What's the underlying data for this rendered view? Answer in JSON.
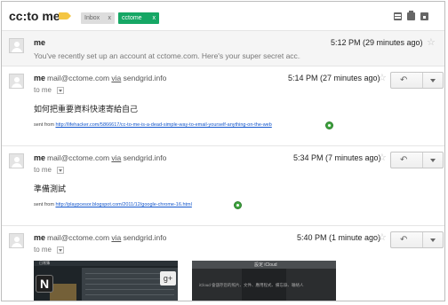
{
  "conversation": {
    "subject": "cc:to me",
    "labels": [
      {
        "text": "Inbox",
        "remove": "x"
      },
      {
        "text": "cctome",
        "remove": "x"
      }
    ],
    "colors": {
      "label_tag": "#f4c542",
      "cctome_chip": "#16a765",
      "link": "#1155cc"
    }
  },
  "header_icons": [
    "expand-all-icon",
    "print-icon",
    "new-window-icon"
  ],
  "messages": [
    {
      "sender": "me",
      "time": "5:12 PM (29 minutes ago)",
      "star": "☆",
      "snippet": "You've recently set up an account at cctome.com. Here's your super secret acc..."
    },
    {
      "sender": "me",
      "email": "mail@cctome.com",
      "via": "via",
      "domain": "sendgrid.info",
      "time": "5:14 PM (27 minutes ago)",
      "star": "☆",
      "to": "to me",
      "body": "如何把重要資料快速寄給自己",
      "sent_from": "sent from",
      "link": "http://lifehacker.com/5866617/cc-to-me-is-a-dead-simple-way-to-email-yourself-anything-on-the-web"
    },
    {
      "sender": "me",
      "email": "mail@cctome.com",
      "via": "via",
      "domain": "sendgrid.info",
      "time": "5:34 PM (7 minutes ago)",
      "star": "☆",
      "to": "to me",
      "body": "準備測試",
      "sent_from": "sent from",
      "link": "http://playpcesor.blogspot.com/2011/12/google-chrome-16.html"
    },
    {
      "sender": "me",
      "email": "mail@cctome.com",
      "via": "via",
      "domain": "sendgrid.info",
      "time": "5:40 PM (1 minute ago)",
      "star": "☆",
      "to": "to me"
    }
  ],
  "thumbnails": {
    "first": {
      "title": "日常簿",
      "tile_letter": "N",
      "badge": "g+"
    },
    "second": {
      "title": "設定 iCloud",
      "text": "iCloud 會儲存您的照片、文件、應用程式、備忘錄、聯絡人"
    }
  }
}
